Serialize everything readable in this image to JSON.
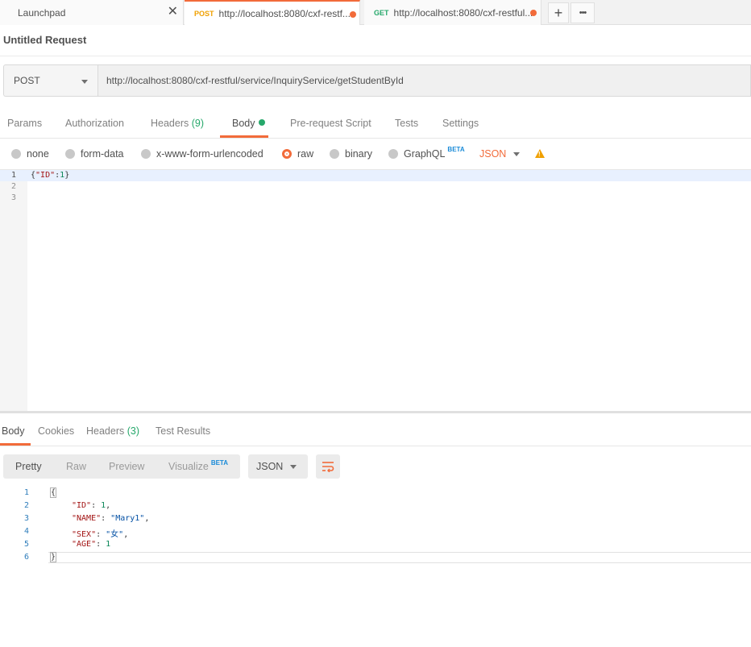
{
  "tabs": [
    {
      "method": "",
      "label": "Launchpad",
      "closable": true
    },
    {
      "method": "POST",
      "label": "http://localhost:8080/cxf-restf...",
      "unsaved": true,
      "active": true
    },
    {
      "method": "GET",
      "label": "http://localhost:8080/cxf-restful...",
      "unsaved": true
    }
  ],
  "tab_actions": {
    "new_tab": "+",
    "more": "•••"
  },
  "request": {
    "title": "Untitled Request",
    "method": "POST",
    "url": "http://localhost:8080/cxf-restful/service/InquiryService/getStudentById"
  },
  "request_tabs": {
    "params": "Params",
    "authorization": "Authorization",
    "headers": "Headers",
    "headers_count": "(9)",
    "body": "Body",
    "prerequest": "Pre-request Script",
    "tests": "Tests",
    "settings": "Settings"
  },
  "body_types": {
    "none": "none",
    "form_data": "form-data",
    "urlencoded": "x-www-form-urlencoded",
    "raw": "raw",
    "binary": "binary",
    "graphql": "GraphQL",
    "graphql_badge": "BETA",
    "format": "JSON",
    "selected": "raw"
  },
  "request_body": {
    "line_numbers": [
      "1",
      "2",
      "3"
    ],
    "line1_open": "{",
    "line1_key": "\"ID\"",
    "line1_sep": ":",
    "line1_val": "1",
    "line1_close": "}"
  },
  "response_tabs": {
    "body": "Body",
    "cookies": "Cookies",
    "headers": "Headers",
    "headers_count": "(3)",
    "test_results": "Test Results"
  },
  "response_view": {
    "pretty": "Pretty",
    "raw": "Raw",
    "preview": "Preview",
    "visualize": "Visualize",
    "visualize_badge": "BETA",
    "format": "JSON"
  },
  "response_body": {
    "line_numbers": [
      "1",
      "2",
      "3",
      "4",
      "5",
      "6"
    ],
    "open": "{",
    "fields": [
      {
        "key": "\"ID\"",
        "value": "1",
        "comma": ","
      },
      {
        "key": "\"NAME\"",
        "value": "\"Mary1\"",
        "comma": ","
      },
      {
        "key": "\"SEX\"",
        "value": "\"女\"",
        "comma": ","
      },
      {
        "key": "\"AGE\"",
        "value": "1",
        "comma": ""
      }
    ],
    "close": "}"
  },
  "colors": {
    "accent": "#f26b3a",
    "count_green": "#26a86b",
    "beta_blue": "#1a8bd8"
  }
}
